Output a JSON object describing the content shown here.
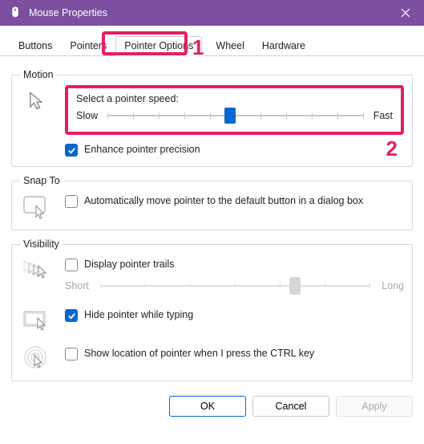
{
  "window": {
    "title": "Mouse Properties"
  },
  "tabs": {
    "items": [
      {
        "label": "Buttons"
      },
      {
        "label": "Pointers"
      },
      {
        "label": "Pointer Options"
      },
      {
        "label": "Wheel"
      },
      {
        "label": "Hardware"
      }
    ],
    "active_index": 2
  },
  "annotations": {
    "one": "1",
    "two": "2"
  },
  "motion": {
    "legend": "Motion",
    "speed_label": "Select a pointer speed:",
    "slow": "Slow",
    "fast": "Fast",
    "speed_value_pct": 48,
    "enhance_checked": true,
    "enhance_label": "Enhance pointer precision"
  },
  "snapto": {
    "legend": "Snap To",
    "auto_checked": false,
    "auto_label": "Automatically move pointer to the default button in a dialog box"
  },
  "visibility": {
    "legend": "Visibility",
    "trails_checked": false,
    "trails_label": "Display pointer trails",
    "short": "Short",
    "long": "Long",
    "trails_value_pct": 72,
    "hide_checked": true,
    "hide_label": "Hide pointer while typing",
    "ctrl_checked": false,
    "ctrl_label": "Show location of pointer when I press the CTRL key"
  },
  "buttons": {
    "ok": "OK",
    "cancel": "Cancel",
    "apply": "Apply"
  }
}
